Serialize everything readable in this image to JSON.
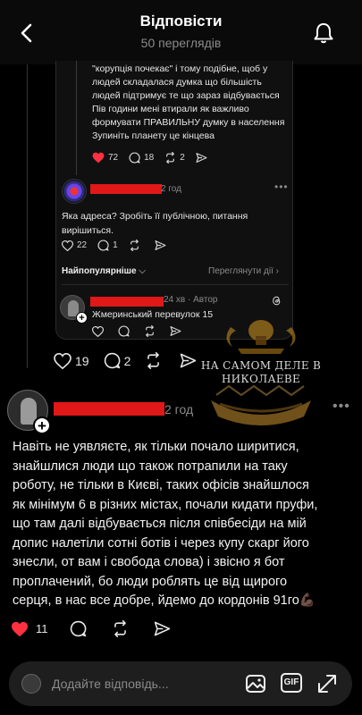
{
  "header": {
    "title": "Відповісти",
    "subtitle": "50 переглядів"
  },
  "quoted": {
    "lines": [
      "\"корупція почекає\" і тому подібне, щоб у",
      "людей складалася думка що більшість",
      "людей підтримує те що зараз відбувається",
      "Пів години мені втирали як важливо",
      "формувати ПРАВИЛЬНУ думку в населення",
      "Зупиніть планету це кінцева"
    ],
    "likes": "72",
    "comments": "18",
    "reposts": "2"
  },
  "reply2": {
    "time": "2 год",
    "text": "Яка адреса? Зробіть її публічною, питання вирішиться.",
    "likes": "22",
    "comments": "1"
  },
  "sort": {
    "top_label": "Найпопулярніше",
    "views_label": "Переглянути дії"
  },
  "reply3": {
    "meta": "24 хв · Автор",
    "text": "Жмеринський перевулок 15"
  },
  "main_actions": {
    "likes": "19",
    "comments": "2"
  },
  "watermark": {
    "line1": "НА САМОМ ДЕЛЕ В",
    "line2": "НИКОЛАЕВЕ"
  },
  "post": {
    "time": "2 год",
    "lines": [
      "Навіть не уявляєте, як тільки почало ширитися,",
      "знайшлися люди що також потрапили на таку",
      "роботу, не тільки в Києві, таких офісів знайшлося",
      "як мінімум 6 в різних містах, почали кидати пруфи,",
      "що там далі відбувається після співбесіди на мій",
      "допис налетіли сотні ботів і через купу скарг його",
      "знесли, от вам і свобода слова) і звісно я бот",
      "проплачений, бо люди роблять це від щирого",
      "серця, в нас все добре, йдемо до кордонів 91го💪🏿"
    ],
    "likes": "11"
  },
  "composer": {
    "placeholder": "Додайте відповідь...",
    "gif_label": "GIF"
  },
  "colors": {
    "background": "#000000",
    "redaction": "#e01818",
    "like_active": "#ff3040",
    "muted_text": "#8a8a8a"
  },
  "icons": [
    "back-arrow-icon",
    "bell-icon",
    "heart-icon",
    "comment-icon",
    "repost-icon",
    "share-icon",
    "threads-icon",
    "image-icon",
    "gif-icon",
    "expand-icon"
  ]
}
